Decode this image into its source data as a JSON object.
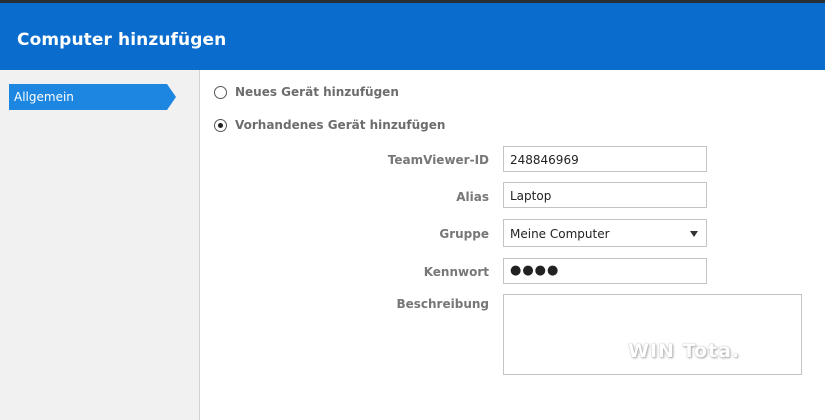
{
  "dialog": {
    "title": "Computer hinzufügen"
  },
  "sidebar": {
    "items": [
      {
        "label": "Allgemein",
        "active": true
      }
    ]
  },
  "options": {
    "new_device": {
      "label": "Neues Gerät hinzufügen",
      "selected": false
    },
    "existing_device": {
      "label": "Vorhandenes Gerät hinzufügen",
      "selected": true
    }
  },
  "form": {
    "teamviewer_id": {
      "label": "TeamViewer-ID",
      "value": "248846969"
    },
    "alias": {
      "label": "Alias",
      "value": "Laptop"
    },
    "group": {
      "label": "Gruppe",
      "value": "Meine Computer"
    },
    "password": {
      "label": "Kennwort",
      "value": "●●●●"
    },
    "description": {
      "label": "Beschreibung",
      "value": ""
    }
  },
  "watermark": {
    "text": "WIN Tota."
  },
  "colors": {
    "header_bg": "#0a6ccd",
    "tab_active": "#1c86e0",
    "sidebar_bg": "#f1f1f1",
    "label_text": "#777777"
  }
}
